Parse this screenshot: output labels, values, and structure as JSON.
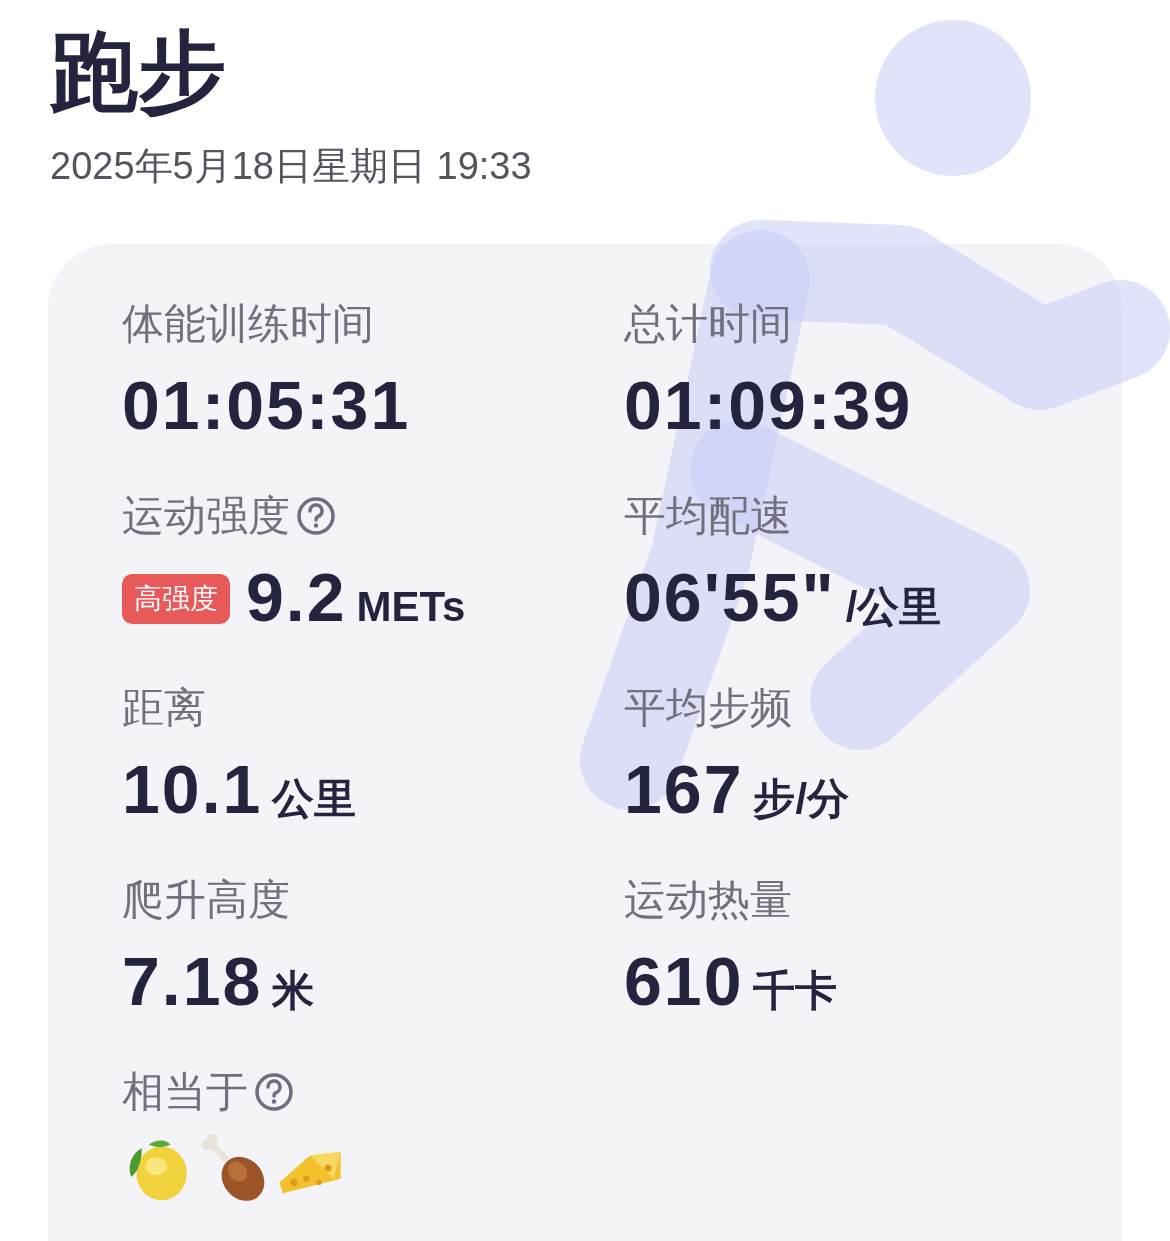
{
  "title": "跑步",
  "datetime": "2025年5月18日星期日 19:33",
  "metrics": [
    {
      "label": "体能训练时间",
      "help": false,
      "value": "01:05:31"
    },
    {
      "label": "总计时间",
      "help": false,
      "value": "01:09:39"
    },
    {
      "label": "运动强度",
      "help": true,
      "badge": {
        "text": "高强度",
        "color": "#e85a5a"
      },
      "value": "9.2",
      "unit": "METs"
    },
    {
      "label": "平均配速",
      "help": false,
      "value": "06'55\"",
      "unit": "/公里"
    },
    {
      "label": "距离",
      "help": false,
      "value": "10.1",
      "unit": "公里"
    },
    {
      "label": "平均步频",
      "help": false,
      "value": "167",
      "unit": "步/分"
    },
    {
      "label": "爬升高度",
      "help": false,
      "value": "7.18",
      "unit": "米"
    },
    {
      "label": "运动热量",
      "help": false,
      "value": "610",
      "unit": "千卡"
    }
  ],
  "equivalent": {
    "label": "相当于",
    "help": true,
    "items": [
      {
        "kind": "lemon"
      },
      {
        "kind": "drumstick"
      },
      {
        "kind": "cheese"
      }
    ]
  }
}
